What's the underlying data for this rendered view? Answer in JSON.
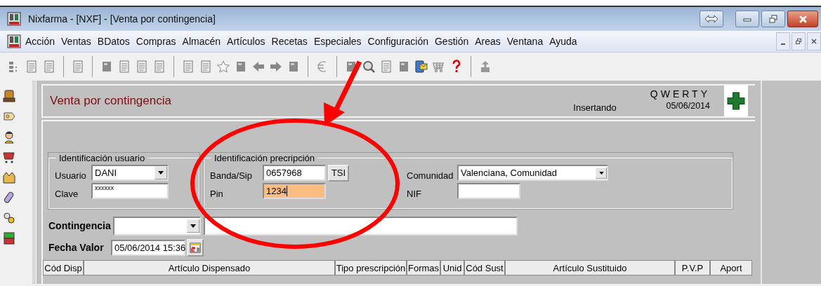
{
  "window": {
    "title": "Nixfarma - [NXF] - [Venta por contingencia]"
  },
  "menu": [
    "Acción",
    "Ventas",
    "BDatos",
    "Compras",
    "Almacén",
    "Artículos",
    "Recetas",
    "Especiales",
    "Configuración",
    "Gestión",
    "Areas",
    "Ventana",
    "Ayuda"
  ],
  "form": {
    "title": "Venta por contingencia",
    "status": "Insertando",
    "user_code": "QWERTY",
    "date": "05/06/2014"
  },
  "user_group": {
    "legend": "Identificación usuario",
    "usuario": {
      "label": "Usuario",
      "value": "DANI"
    },
    "clave": {
      "label": "Clave",
      "value": "xxxxxx"
    }
  },
  "prescription_group": {
    "legend": "Identificación precripción",
    "banda": {
      "label": "Banda/Sip",
      "value": "0657968",
      "focused": false
    },
    "tsi_button": "TSI",
    "pin": {
      "label": "Pin",
      "value": "1234",
      "focused": true
    },
    "comunidad": {
      "label": "Comunidad",
      "value": "Valenciana, Comunidad"
    },
    "nif": {
      "label": "NIF"
    }
  },
  "contingencia": {
    "label": "Contingencia"
  },
  "fecha_valor": {
    "label": "Fecha Valor",
    "value": "05/06/2014 15:36"
  },
  "table": {
    "columns": [
      "Cód Disp",
      "Artículo Dispensado",
      "Tipo prescripción",
      "Formas",
      "Unid",
      "Cód Sust",
      "Artículo Sustituido",
      "P.V.P",
      "Aport"
    ]
  }
}
